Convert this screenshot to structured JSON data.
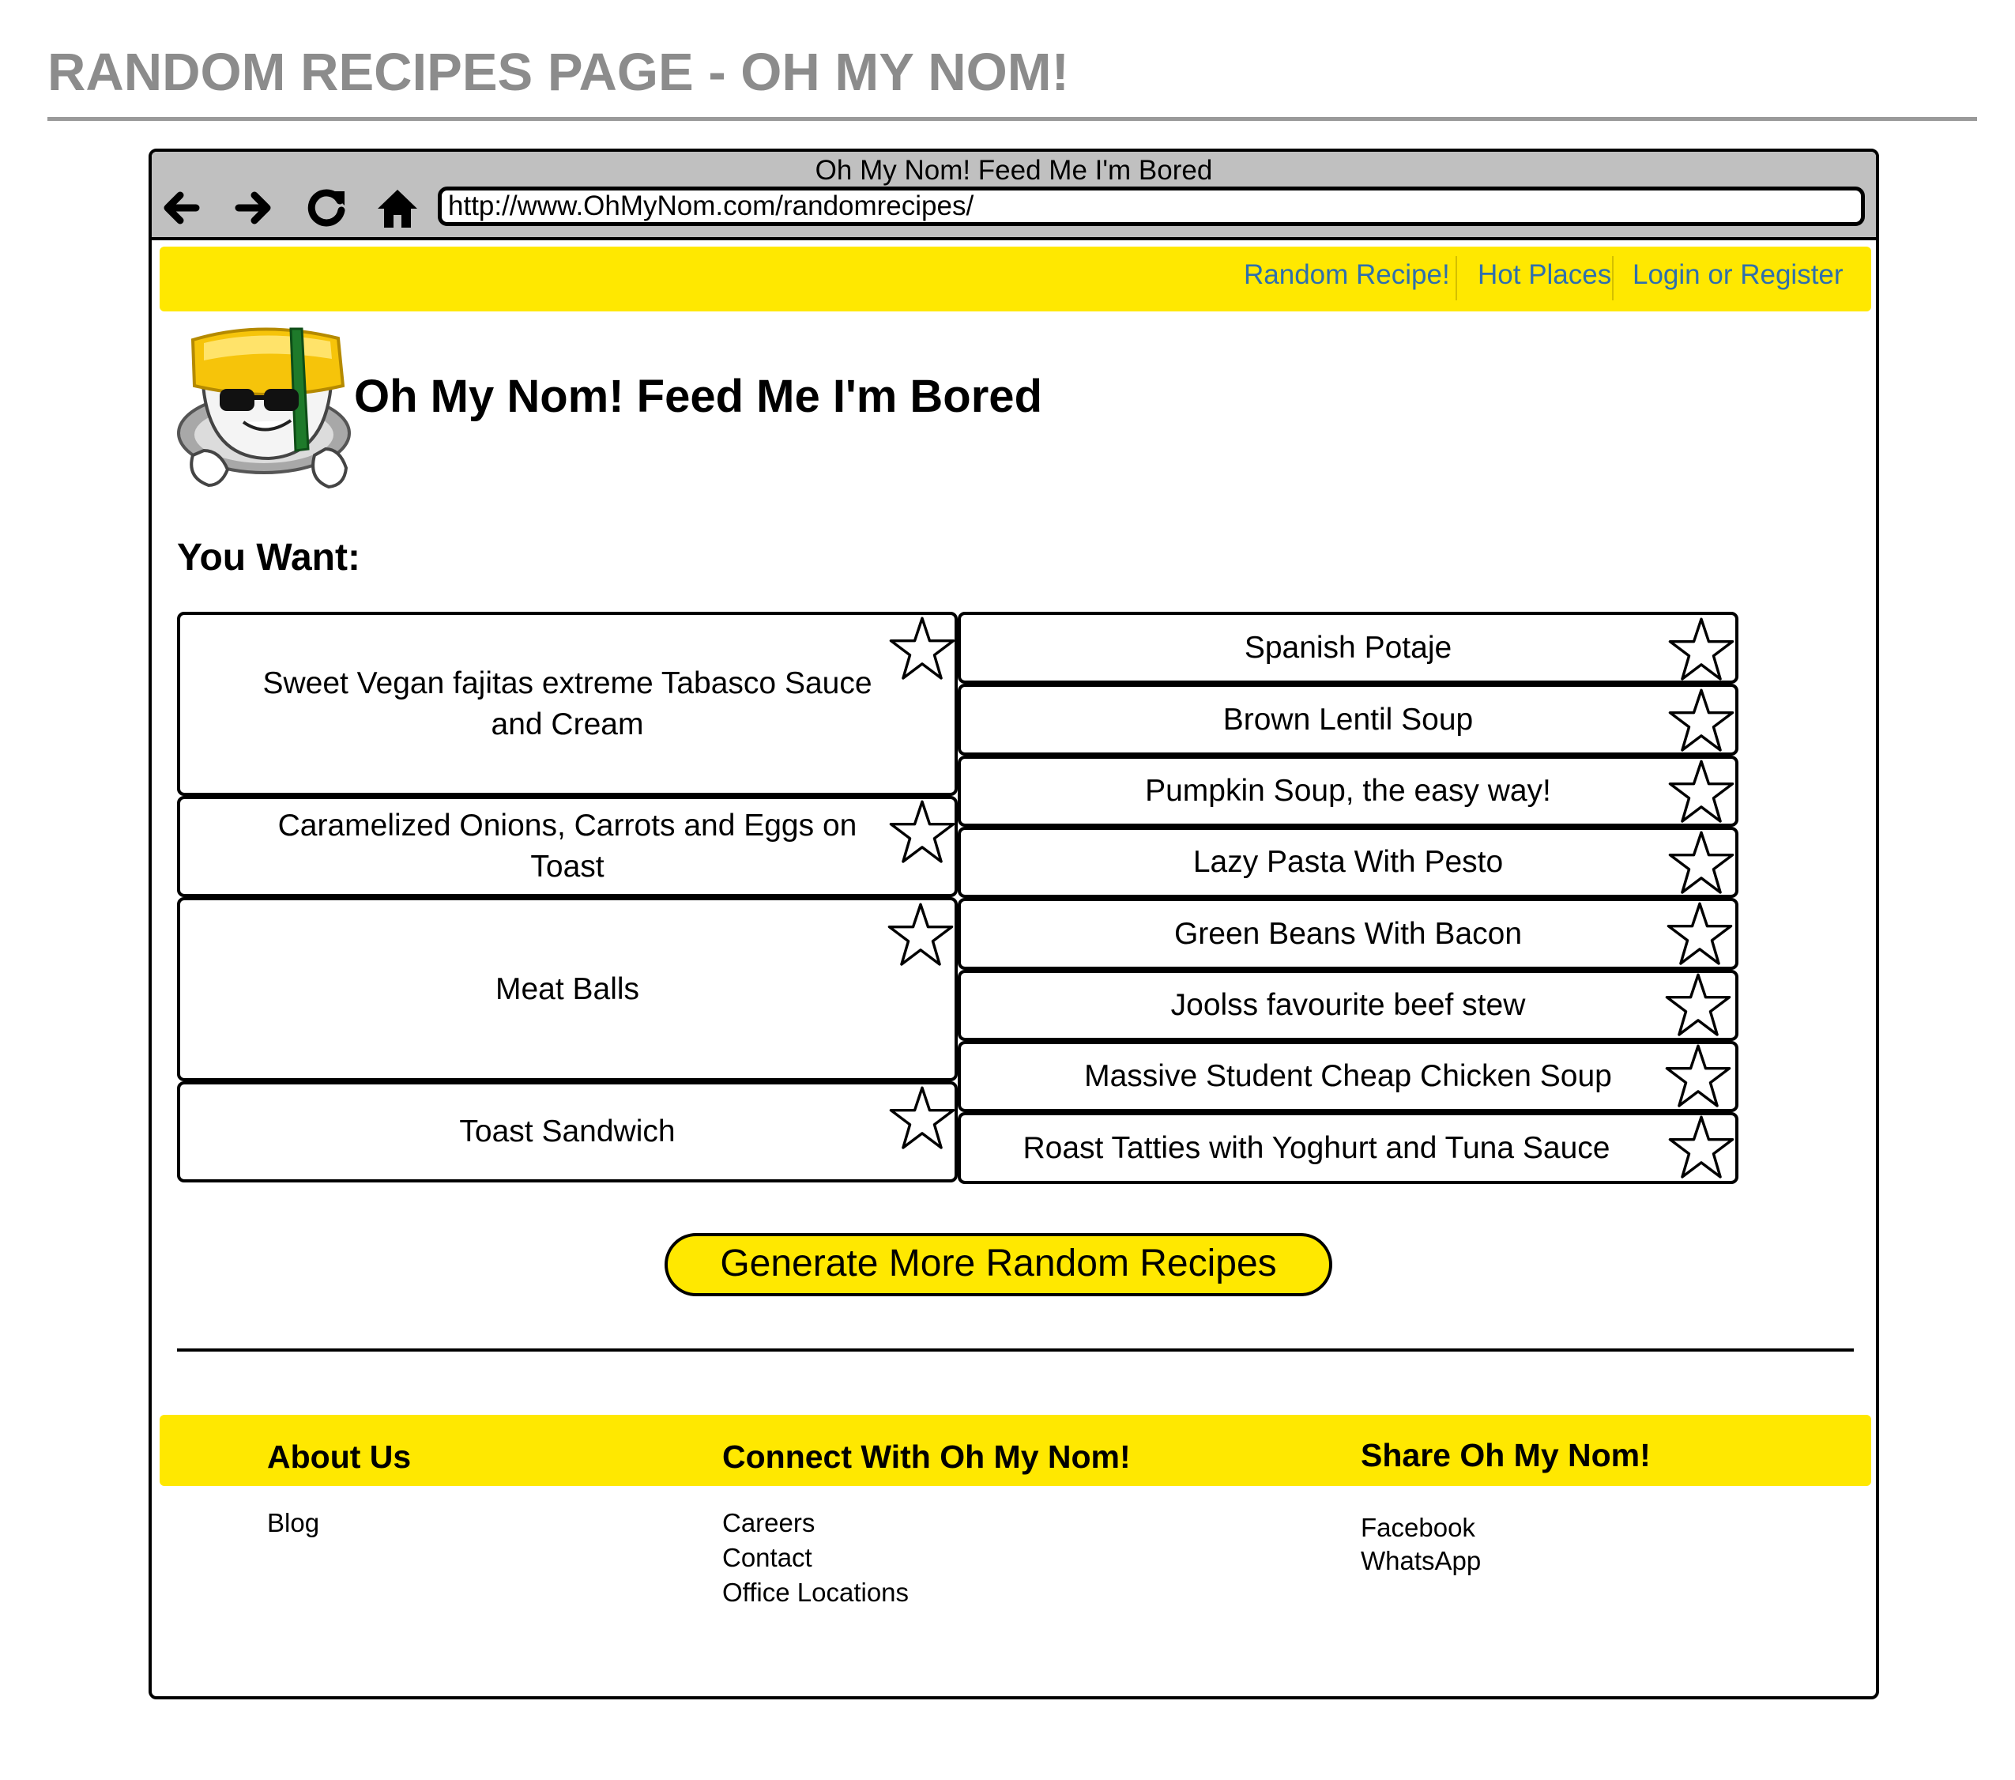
{
  "page_title": "RANDOM RECIPES PAGE - OH MY NOM!",
  "browser": {
    "window_title": "Oh My Nom! Feed Me I'm Bored",
    "url": "http://www.OhMyNom.com/randomrecipes/",
    "icons": [
      "back-arrow-icon",
      "forward-arrow-icon",
      "reload-icon",
      "home-icon"
    ]
  },
  "nav": {
    "links": [
      "Random Recipe!",
      "Hot Places",
      "Login or Register"
    ],
    "link_color": "#2e6fad",
    "bar_color": "#ffe800"
  },
  "site": {
    "title": "Oh My Nom! Feed Me I'm Bored",
    "logo": "sushi-mascot-with-sunglasses"
  },
  "main": {
    "heading": "You Want:",
    "left_recipes": [
      "Sweet Vegan fajitas extreme Tabasco Sauce and Cream",
      "Caramelized Onions, Carrots and Eggs on Toast",
      "Meat Balls",
      "Toast Sandwich"
    ],
    "right_recipes": [
      "Spanish Potaje",
      "Brown Lentil Soup",
      "Pumpkin Soup, the easy way!",
      "Lazy Pasta With Pesto",
      "Green Beans With Bacon",
      "Joolss favourite beef stew",
      "Massive Student Cheap Chicken Soup",
      "Roast Tatties with Yoghurt and Tuna Sauce"
    ],
    "favorite_icon": "star-outline-icon",
    "generate_button": "Generate More Random Recipes"
  },
  "footer": {
    "columns": [
      {
        "heading": "About Us",
        "links": [
          "Blog"
        ]
      },
      {
        "heading": "Connect With Oh My Nom!",
        "links": [
          "Careers",
          "Contact",
          "Office Locations"
        ]
      },
      {
        "heading": "Share Oh My Nom!",
        "links": [
          "Facebook",
          "WhatsApp"
        ]
      }
    ]
  }
}
